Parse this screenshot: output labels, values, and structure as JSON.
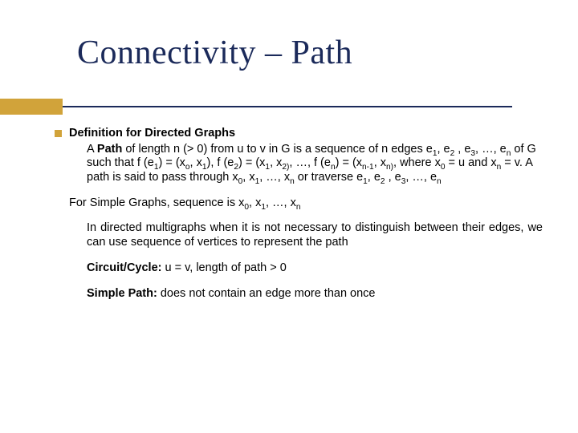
{
  "title": "Connectivity – Path",
  "def_heading": "Definition for Directed Graphs",
  "def_body_html": "A <b>Path</b> of length n (> 0) from u to v in G is a sequence of n edges e<sub>1</sub>, e<sub>2</sub> , e<sub>3</sub>, …, e<sub>n</sub> of G such that f (e<sub>1</sub>) = (x<sub>o</sub>, x<sub>1</sub>), f (e<sub>2</sub>) = (x<sub>1</sub>, x<sub>2)</sub>, …, f (e<sub>n</sub>) = (x<sub>n-1</sub>, x<sub>n)</sub>, where x<sub>0</sub> = u and x<sub>n</sub> = v. A path is said to pass through x<sub>0</sub>, x<sub>1</sub>, …, x<sub>n</sub> or traverse e<sub>1</sub>, e<sub>2</sub> , e<sub>3</sub>, …, e<sub>n</sub>",
  "simple_graphs_html": "For Simple Graphs, sequence is x<sub>0</sub>, x<sub>1</sub>, …, x<sub>n</sub>",
  "multigraphs_html": "In directed multigraphs when it is not necessary to distinguish between their edges, we can use sequence of vertices to represent the path",
  "circuit_html": "<b>Circuit/Cycle:</b> u = v, length of path > 0",
  "simple_path_html": "<b>Simple Path:</b> does not contain an edge more than once"
}
